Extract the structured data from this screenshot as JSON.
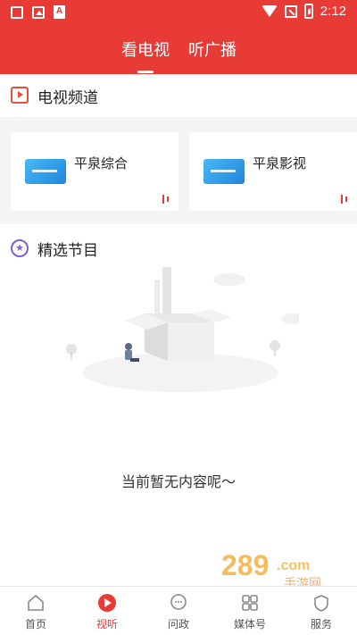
{
  "statusbar": {
    "time": "2:12"
  },
  "tabs": [
    {
      "label": "看电视"
    },
    {
      "label": "听广播"
    }
  ],
  "tv_section": {
    "title": "电视频道"
  },
  "channels": [
    {
      "name": "平泉综合"
    },
    {
      "name": "平泉影视"
    }
  ],
  "featured": {
    "title": "精选节目",
    "empty_text": "当前暂无内容呢～"
  },
  "bottom_nav": [
    {
      "label": "首页",
      "icon": "home-icon"
    },
    {
      "label": "视听",
      "icon": "play-icon"
    },
    {
      "label": "问政",
      "icon": "chat-icon"
    },
    {
      "label": "媒体号",
      "icon": "grid-icon"
    },
    {
      "label": "服务",
      "icon": "service-icon"
    }
  ],
  "colors": {
    "brand": "#e83b36",
    "nav_active": "#e83b36"
  }
}
